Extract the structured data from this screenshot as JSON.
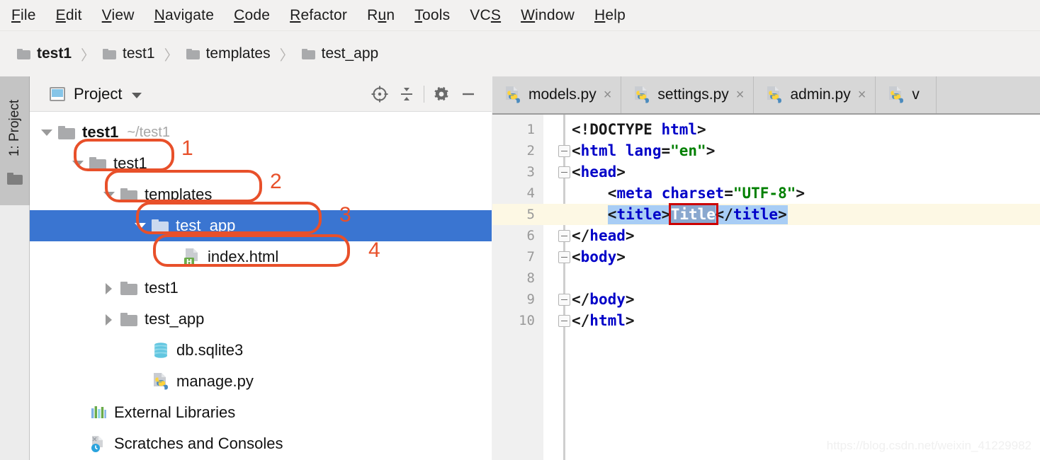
{
  "menu": {
    "items": [
      {
        "pre": "",
        "key": "F",
        "post": "ile"
      },
      {
        "pre": "",
        "key": "E",
        "post": "dit"
      },
      {
        "pre": "",
        "key": "V",
        "post": "iew"
      },
      {
        "pre": "",
        "key": "N",
        "post": "avigate"
      },
      {
        "pre": "",
        "key": "C",
        "post": "ode"
      },
      {
        "pre": "",
        "key": "R",
        "post": "efactor"
      },
      {
        "pre": "R",
        "key": "u",
        "post": "n"
      },
      {
        "pre": "",
        "key": "T",
        "post": "ools"
      },
      {
        "pre": "VC",
        "key": "S",
        "post": ""
      },
      {
        "pre": "",
        "key": "W",
        "post": "indow"
      },
      {
        "pre": "",
        "key": "H",
        "post": "elp"
      }
    ]
  },
  "breadcrumb": {
    "items": [
      "test1",
      "test1",
      "templates",
      "test_app"
    ],
    "separator": "〉"
  },
  "panel": {
    "title": "Project",
    "icons": [
      "locate-icon",
      "collapse-all-icon",
      "gear-icon",
      "minimize-icon"
    ]
  },
  "leftbar": {
    "label": "1: Project"
  },
  "tree": {
    "rows": [
      {
        "label": "test1",
        "path": "~/test1",
        "indent": 12,
        "arrow": "down",
        "icon": "folder",
        "bold": true,
        "selected": false
      },
      {
        "label": "test1",
        "path": "",
        "indent": 56,
        "arrow": "down",
        "icon": "folder",
        "bold": false,
        "selected": false
      },
      {
        "label": "templates",
        "path": "",
        "indent": 100,
        "arrow": "down",
        "icon": "folder",
        "bold": false,
        "selected": false
      },
      {
        "label": "test_app",
        "path": "",
        "indent": 144,
        "arrow": "down",
        "icon": "folder",
        "bold": false,
        "selected": true
      },
      {
        "label": "index.html",
        "path": "",
        "indent": 188,
        "arrow": "none",
        "icon": "html-file",
        "bold": false,
        "selected": false
      },
      {
        "label": "test1",
        "path": "",
        "indent": 100,
        "arrow": "right",
        "icon": "folder",
        "bold": false,
        "selected": false
      },
      {
        "label": "test_app",
        "path": "",
        "indent": 100,
        "arrow": "right",
        "icon": "folder",
        "bold": false,
        "selected": false
      },
      {
        "label": "db.sqlite3",
        "path": "",
        "indent": 144,
        "arrow": "none",
        "icon": "database",
        "bold": false,
        "selected": false
      },
      {
        "label": "manage.py",
        "path": "",
        "indent": 144,
        "arrow": "none",
        "icon": "python-file",
        "bold": false,
        "selected": false
      },
      {
        "label": "External Libraries",
        "path": "",
        "indent": 56,
        "arrow": "none",
        "icon": "library",
        "bold": false,
        "selected": false
      },
      {
        "label": "Scratches and Consoles",
        "path": "",
        "indent": 56,
        "arrow": "none",
        "icon": "scratches",
        "bold": false,
        "selected": false
      }
    ]
  },
  "annotations": {
    "accent_color": "#e8502a",
    "numbers": [
      "1",
      "2",
      "3",
      "4"
    ]
  },
  "tabs": [
    {
      "label": "models.py",
      "icon": "python-file-icon",
      "close": "×"
    },
    {
      "label": "settings.py",
      "icon": "python-file-icon",
      "close": "×"
    },
    {
      "label": "admin.py",
      "icon": "python-file-icon",
      "close": "×"
    },
    {
      "label": "v",
      "icon": "python-file-icon",
      "close": ""
    }
  ],
  "code": {
    "lines": [
      {
        "no": "1",
        "indent": 0,
        "fold": false,
        "segments": [
          {
            "t": "<!DOCTYPE ",
            "c": "pl"
          },
          {
            "t": "html",
            "c": "tg"
          },
          {
            "t": ">",
            "c": "pl"
          }
        ]
      },
      {
        "no": "2",
        "indent": 0,
        "fold": true,
        "segments": [
          {
            "t": "<",
            "c": "pl"
          },
          {
            "t": "html",
            "c": "tg"
          },
          {
            "t": " ",
            "c": "pl"
          },
          {
            "t": "lang",
            "c": "at"
          },
          {
            "t": "=",
            "c": "pl"
          },
          {
            "t": "\"en\"",
            "c": "st"
          },
          {
            "t": ">",
            "c": "pl"
          }
        ]
      },
      {
        "no": "3",
        "indent": 0,
        "fold": true,
        "segments": [
          {
            "t": "<",
            "c": "pl"
          },
          {
            "t": "head",
            "c": "tg"
          },
          {
            "t": ">",
            "c": "pl"
          }
        ]
      },
      {
        "no": "4",
        "indent": 4,
        "fold": false,
        "segments": [
          {
            "t": "<",
            "c": "pl"
          },
          {
            "t": "meta",
            "c": "tg"
          },
          {
            "t": " ",
            "c": "pl"
          },
          {
            "t": "charset",
            "c": "at"
          },
          {
            "t": "=",
            "c": "pl"
          },
          {
            "t": "\"UTF-8\"",
            "c": "st"
          },
          {
            "t": ">",
            "c": "pl"
          }
        ]
      },
      {
        "no": "5",
        "indent": 4,
        "fold": false,
        "current": true,
        "segments": [
          {
            "t": "<",
            "c": "pl"
          },
          {
            "t": "title",
            "c": "tg"
          },
          {
            "t": ">",
            "c": "pl"
          },
          {
            "t": "Title",
            "c": "pl"
          },
          {
            "t": "</",
            "c": "pl"
          },
          {
            "t": "title",
            "c": "tg"
          },
          {
            "t": ">",
            "c": "pl"
          }
        ]
      },
      {
        "no": "6",
        "indent": 0,
        "fold": true,
        "segments": [
          {
            "t": "</",
            "c": "pl"
          },
          {
            "t": "head",
            "c": "tg"
          },
          {
            "t": ">",
            "c": "pl"
          }
        ]
      },
      {
        "no": "7",
        "indent": 0,
        "fold": true,
        "segments": [
          {
            "t": "<",
            "c": "pl"
          },
          {
            "t": "body",
            "c": "tg"
          },
          {
            "t": ">",
            "c": "pl"
          }
        ]
      },
      {
        "no": "8",
        "indent": 0,
        "fold": false,
        "segments": []
      },
      {
        "no": "9",
        "indent": 0,
        "fold": true,
        "segments": [
          {
            "t": "</",
            "c": "pl"
          },
          {
            "t": "body",
            "c": "tg"
          },
          {
            "t": ">",
            "c": "pl"
          }
        ]
      },
      {
        "no": "10",
        "indent": 0,
        "fold": true,
        "segments": [
          {
            "t": "</",
            "c": "pl"
          },
          {
            "t": "html",
            "c": "tg"
          },
          {
            "t": ">",
            "c": "pl"
          }
        ]
      }
    ],
    "selected_token": "Title"
  },
  "watermark": "https://blog.csdn.net/weixin_41229982"
}
